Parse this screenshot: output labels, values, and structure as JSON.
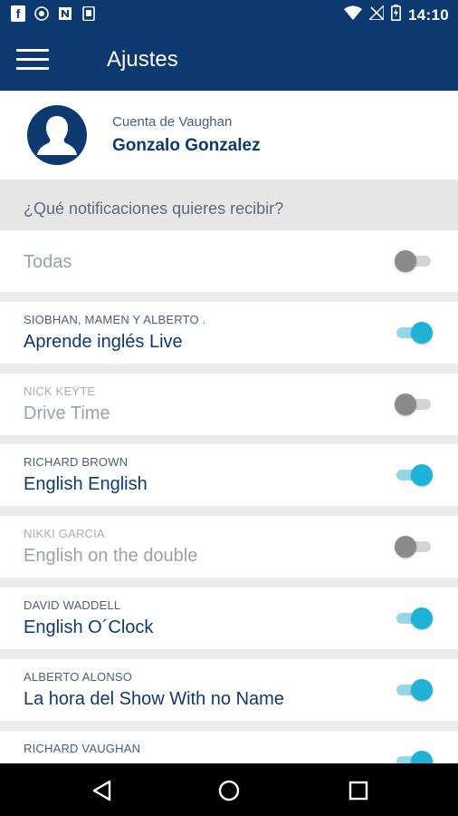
{
  "status_bar": {
    "time": "14:10",
    "left_icons": [
      "facebook-icon",
      "shield-icon",
      "n-app-icon",
      "phone-app-icon"
    ],
    "right_icons": [
      "wifi-icon",
      "no-signal-icon",
      "battery-icon"
    ]
  },
  "app_bar": {
    "title": "Ajustes",
    "menu_icon": "hamburger-icon"
  },
  "profile": {
    "subtitle": "Cuenta de Vaughan",
    "name": "Gonzalo Gonzalez",
    "avatar_icon": "user-silhouette-icon"
  },
  "section_header": "¿Qué notificaciones quieres recibir?",
  "rows": [
    {
      "presenter": "",
      "program": "Todas",
      "enabled": false
    },
    {
      "presenter": "SIOBHAN, MAMEN Y ALBERTO .",
      "program": "Aprende inglés Live",
      "enabled": true
    },
    {
      "presenter": "NICK KEYTE",
      "program": "Drive Time",
      "enabled": false
    },
    {
      "presenter": "RICHARD BROWN",
      "program": "English English",
      "enabled": true
    },
    {
      "presenter": "NIKKI GARCIA",
      "program": "English on the double",
      "enabled": false
    },
    {
      "presenter": "DAVID WADDELL",
      "program": "English O´Clock",
      "enabled": true
    },
    {
      "presenter": "ALBERTO ALONSO",
      "program": "La hora del Show With no Name",
      "enabled": true
    },
    {
      "presenter": "RICHARD VAUGHAN",
      "program": "",
      "enabled": true
    }
  ],
  "nav_bar": {
    "back_icon": "back-triangle-icon",
    "home_icon": "home-circle-icon",
    "recents_icon": "recents-square-icon"
  },
  "colors": {
    "primary": "#0c3a70",
    "toggle_on": "#1eb3d6",
    "toggle_off": "#8a8a8a",
    "background": "#ececec"
  }
}
